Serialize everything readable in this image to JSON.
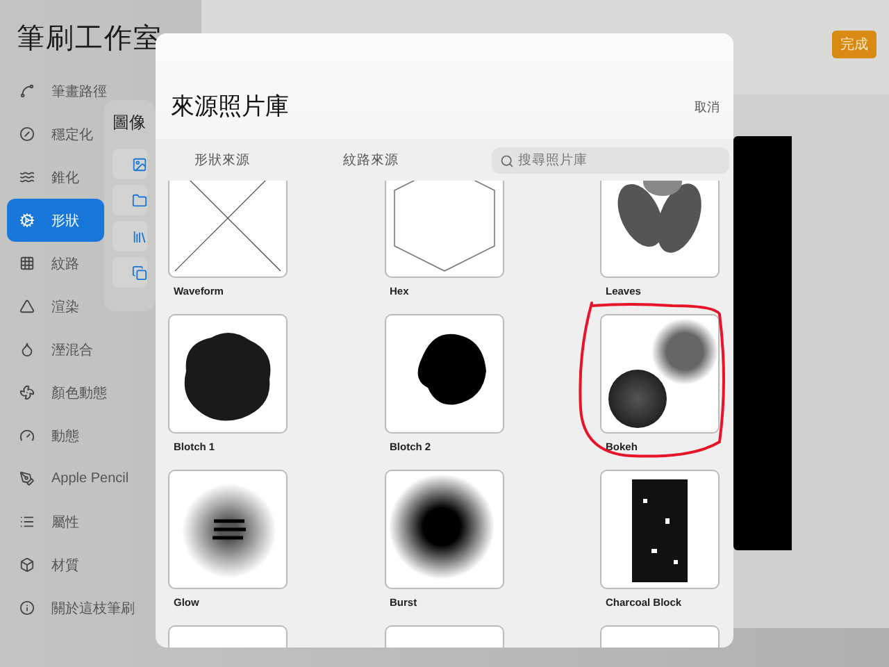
{
  "sidebar": {
    "title": "筆刷工作室",
    "items": [
      {
        "label": "筆畫路徑",
        "selected": false
      },
      {
        "label": "穩定化",
        "selected": false
      },
      {
        "label": "錐化",
        "selected": false
      },
      {
        "label": "形狀",
        "selected": true
      },
      {
        "label": "紋路",
        "selected": false
      },
      {
        "label": "渲染",
        "selected": false
      },
      {
        "label": "溼混合",
        "selected": false
      },
      {
        "label": "顏色動態",
        "selected": false
      },
      {
        "label": "動態",
        "selected": false
      },
      {
        "label": "Apple Pencil",
        "selected": false
      },
      {
        "label": "屬性",
        "selected": false
      },
      {
        "label": "材質",
        "selected": false
      },
      {
        "label": "關於這枝筆刷",
        "selected": false
      }
    ]
  },
  "popover": {
    "title": "圖像"
  },
  "done_button": "完成",
  "modal": {
    "title": "來源照片庫",
    "cancel": "取消",
    "tabs": [
      {
        "label": "形狀來源",
        "selected": false
      },
      {
        "label": "紋路來源",
        "selected": false
      }
    ],
    "search": {
      "placeholder": "搜尋照片庫"
    },
    "tiles": [
      {
        "kind": "waveform",
        "label": "Waveform",
        "circled": false
      },
      {
        "kind": "hex",
        "label": "Hex",
        "circled": false
      },
      {
        "kind": "leaves",
        "label": "Leaves",
        "circled": false
      },
      {
        "kind": "blotch",
        "label": "Blotch 1",
        "circled": false
      },
      {
        "kind": "blotch2",
        "label": "Blotch 2",
        "circled": false
      },
      {
        "kind": "bokeh",
        "label": "Bokeh",
        "circled": true
      },
      {
        "kind": "glow",
        "label": "Glow",
        "circled": false
      },
      {
        "kind": "burst",
        "label": "Burst",
        "circled": false
      },
      {
        "kind": "charcoal",
        "label": "Charcoal Block",
        "circled": false
      },
      {
        "kind": "blank"
      },
      {
        "kind": "blank"
      },
      {
        "kind": "blank"
      }
    ]
  }
}
